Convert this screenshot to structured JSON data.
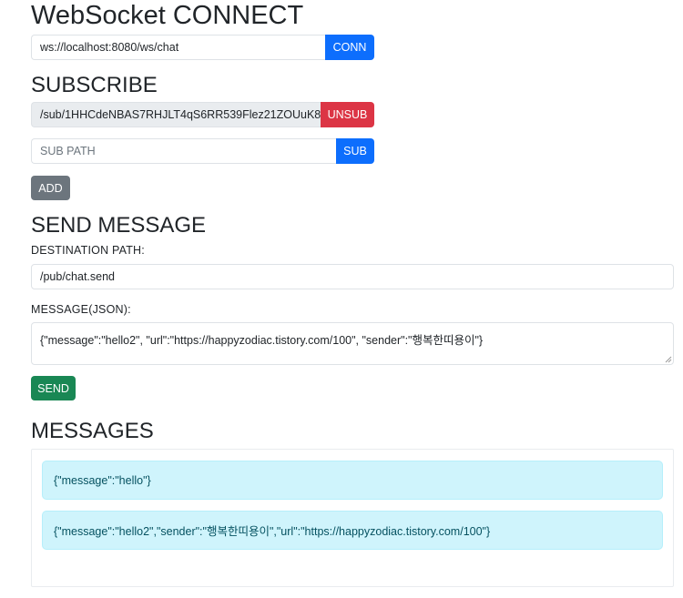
{
  "connect": {
    "title": "WebSocket CONNECT",
    "url_value": "ws://localhost:8080/ws/chat",
    "button": "CONN"
  },
  "subscribe": {
    "title": "SUBSCRIBE",
    "current_path": "/sub/1HHCdeNBAS7RHJLT4qS6RR539Flez21ZOUuK8",
    "unsub_button": "UNSUB",
    "sub_path_placeholder": "SUB PATH",
    "sub_button": "SUB",
    "add_button": "ADD"
  },
  "send": {
    "title": "SEND MESSAGE",
    "destination_label": "DESTINATION PATH:",
    "destination_value": "/pub/chat.send",
    "message_label": "MESSAGE(JSON):",
    "message_value": "{\"message\":\"hello2\", \"url\":\"https://happyzodiac.tistory.com/100\", \"sender\":\"행복한띠용이\"}",
    "send_button": "SEND"
  },
  "messages": {
    "title": "MESSAGES",
    "items": [
      "{\"message\":\"hello\"}",
      "{\"message\":\"hello2\",\"sender\":\"행복한띠용이\",\"url\":\"https://happyzodiac.tistory.com/100\"}"
    ]
  },
  "colors": {
    "primary": "#0d6efd",
    "danger": "#dc3545",
    "secondary": "#6c757d",
    "success": "#198754",
    "info_bg": "#cff4fc",
    "info_text": "#055160"
  }
}
